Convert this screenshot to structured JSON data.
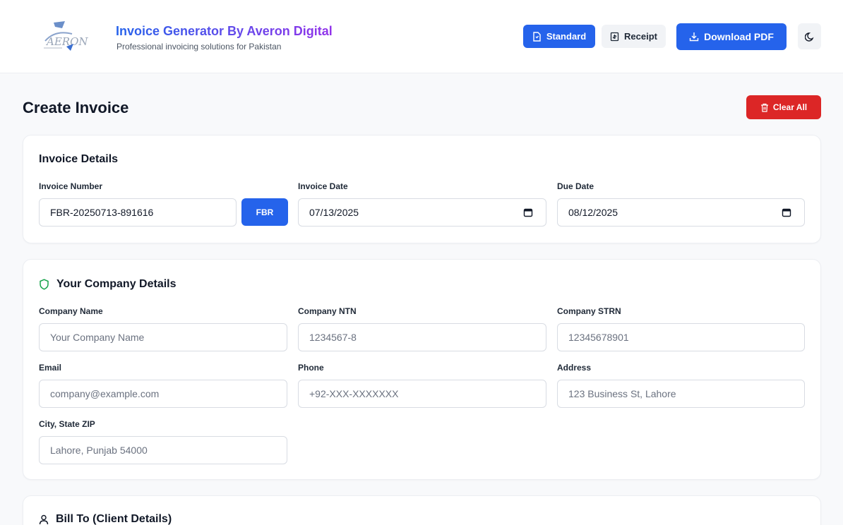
{
  "header": {
    "brand_title": "Invoice Generator By Averon Digital",
    "brand_subtitle": "Professional invoicing solutions for Pakistan",
    "logo_text": "AERON",
    "standard_label": "Standard",
    "receipt_label": "Receipt",
    "download_label": "Download PDF"
  },
  "page": {
    "title": "Create Invoice",
    "clear_label": "Clear All"
  },
  "invoice_details": {
    "title": "Invoice Details",
    "number_label": "Invoice Number",
    "number_value": "FBR-20250713-891616",
    "fbr_label": "FBR",
    "date_label": "Invoice Date",
    "date_value": "07/13/2025",
    "due_label": "Due Date",
    "due_value": "08/12/2025"
  },
  "company": {
    "title": "Your Company Details",
    "name_label": "Company Name",
    "name_placeholder": "Your Company Name",
    "ntn_label": "Company NTN",
    "ntn_placeholder": "1234567-8",
    "strn_label": "Company STRN",
    "strn_placeholder": "12345678901",
    "email_label": "Email",
    "email_placeholder": "company@example.com",
    "phone_label": "Phone",
    "phone_placeholder": "+92-XXX-XXXXXXX",
    "address_label": "Address",
    "address_placeholder": "123 Business St, Lahore",
    "city_label": "City, State ZIP",
    "city_placeholder": "Lahore, Punjab 54000"
  },
  "bill_to": {
    "title": "Bill To (Client Details)"
  },
  "icons": {
    "standard": "file-text-icon",
    "receipt": "receipt-icon",
    "download": "download-icon",
    "theme": "moon-icon",
    "clear": "trash-icon",
    "company": "shield-icon",
    "bill_to": "user-icon",
    "calendar": "calendar-icon"
  },
  "colors": {
    "primary": "#2563eb",
    "danger": "#dc2626",
    "brand_gradient_start": "#2563eb",
    "brand_gradient_end": "#9333ea",
    "shield": "#16a34a"
  }
}
